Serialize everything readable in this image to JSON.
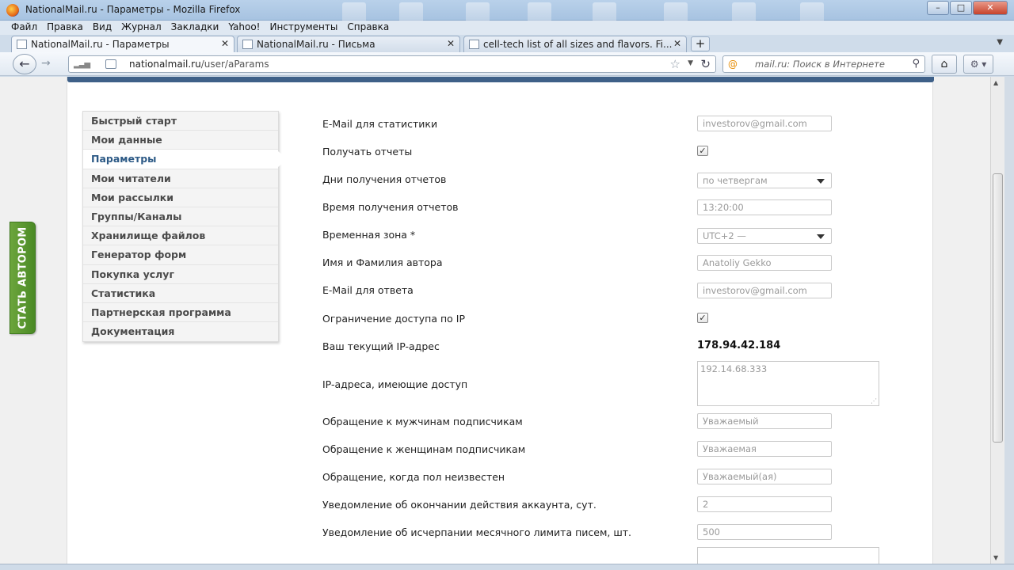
{
  "window": {
    "title": "NationalMail.ru - Параметры - Mozilla Firefox",
    "min_label": "–",
    "max_label": "□",
    "close_label": "✕"
  },
  "menubar": [
    "Файл",
    "Правка",
    "Вид",
    "Журнал",
    "Закладки",
    "Yahoo!",
    "Инструменты",
    "Справка"
  ],
  "tabs": [
    {
      "label": "NationalMail.ru - Параметры",
      "close": "✕",
      "active": true
    },
    {
      "label": "NationalMail.ru - Письма",
      "close": "✕",
      "active": false
    },
    {
      "label": "cell-tech list of all sizes and flavors. Fi...",
      "close": "✕",
      "active": false
    }
  ],
  "newtab_label": "+",
  "navbar": {
    "back_glyph": "←",
    "forward_glyph": "→",
    "url_host": "nationalmail.ru",
    "url_path": "/user/aParams",
    "star": "☆",
    "reload": "↻",
    "search_engine": "@",
    "search_placeholder": "mail.ru: Поиск в Интернете",
    "search_glyph": "⚲",
    "home_glyph": "⌂",
    "tools_glyph": "⚙ ▾"
  },
  "side_tab": {
    "label": "СТАТЬ АВТОРОМ"
  },
  "side_menu": {
    "items": [
      "Быстрый старт",
      "Мои данные",
      "Параметры",
      "Мои читатели",
      "Мои рассылки",
      "Группы/Каналы",
      "Хранилище файлов",
      "Генератор форм",
      "Покупка услуг",
      "Статистика",
      "Партнерская программа",
      "Документация"
    ],
    "active_index": 2
  },
  "form": {
    "stats_email": {
      "label": "E-Mail для статистики",
      "value": "investorov@gmail.com"
    },
    "receive_reports": {
      "label": "Получать отчеты",
      "checked": true
    },
    "report_days": {
      "label": "Дни получения отчетов",
      "value": "по четвергам"
    },
    "report_time": {
      "label": "Время получения отчетов",
      "value": "13:20:00"
    },
    "timezone": {
      "label": "Временная зона *",
      "value": "UTC+2 —"
    },
    "author_name": {
      "label": "Имя и Фамилия автора",
      "value": "Anatoliy Gekko"
    },
    "reply_email": {
      "label": "E-Mail для ответа",
      "value": "investorov@gmail.com"
    },
    "ip_restriction": {
      "label": "Ограничение доступа по IP",
      "checked": true
    },
    "current_ip": {
      "label": "Ваш текущий IP-адрес",
      "value": "178.94.42.184"
    },
    "allowed_ips": {
      "label": "IP-адреса, имеющие доступ",
      "value": "192.14.68.333"
    },
    "greeting_male": {
      "label": "Обращение к мужчинам подписчикам",
      "value": "Уважаемый"
    },
    "greeting_female": {
      "label": "Обращение к женщинам подписчикам",
      "value": "Уважаемая"
    },
    "greeting_unknown": {
      "label": "Обращение, когда пол неизвестен",
      "value": "Уважаемый(ая)"
    },
    "account_expiry_notice": {
      "label": "Уведомление об окончании действия аккаунта, сут.",
      "value": "2"
    },
    "monthly_limit_notice": {
      "label": "Уведомление об исчерпании месячного лимита писем, шт.",
      "value": "500"
    }
  },
  "check_glyph": "✓"
}
